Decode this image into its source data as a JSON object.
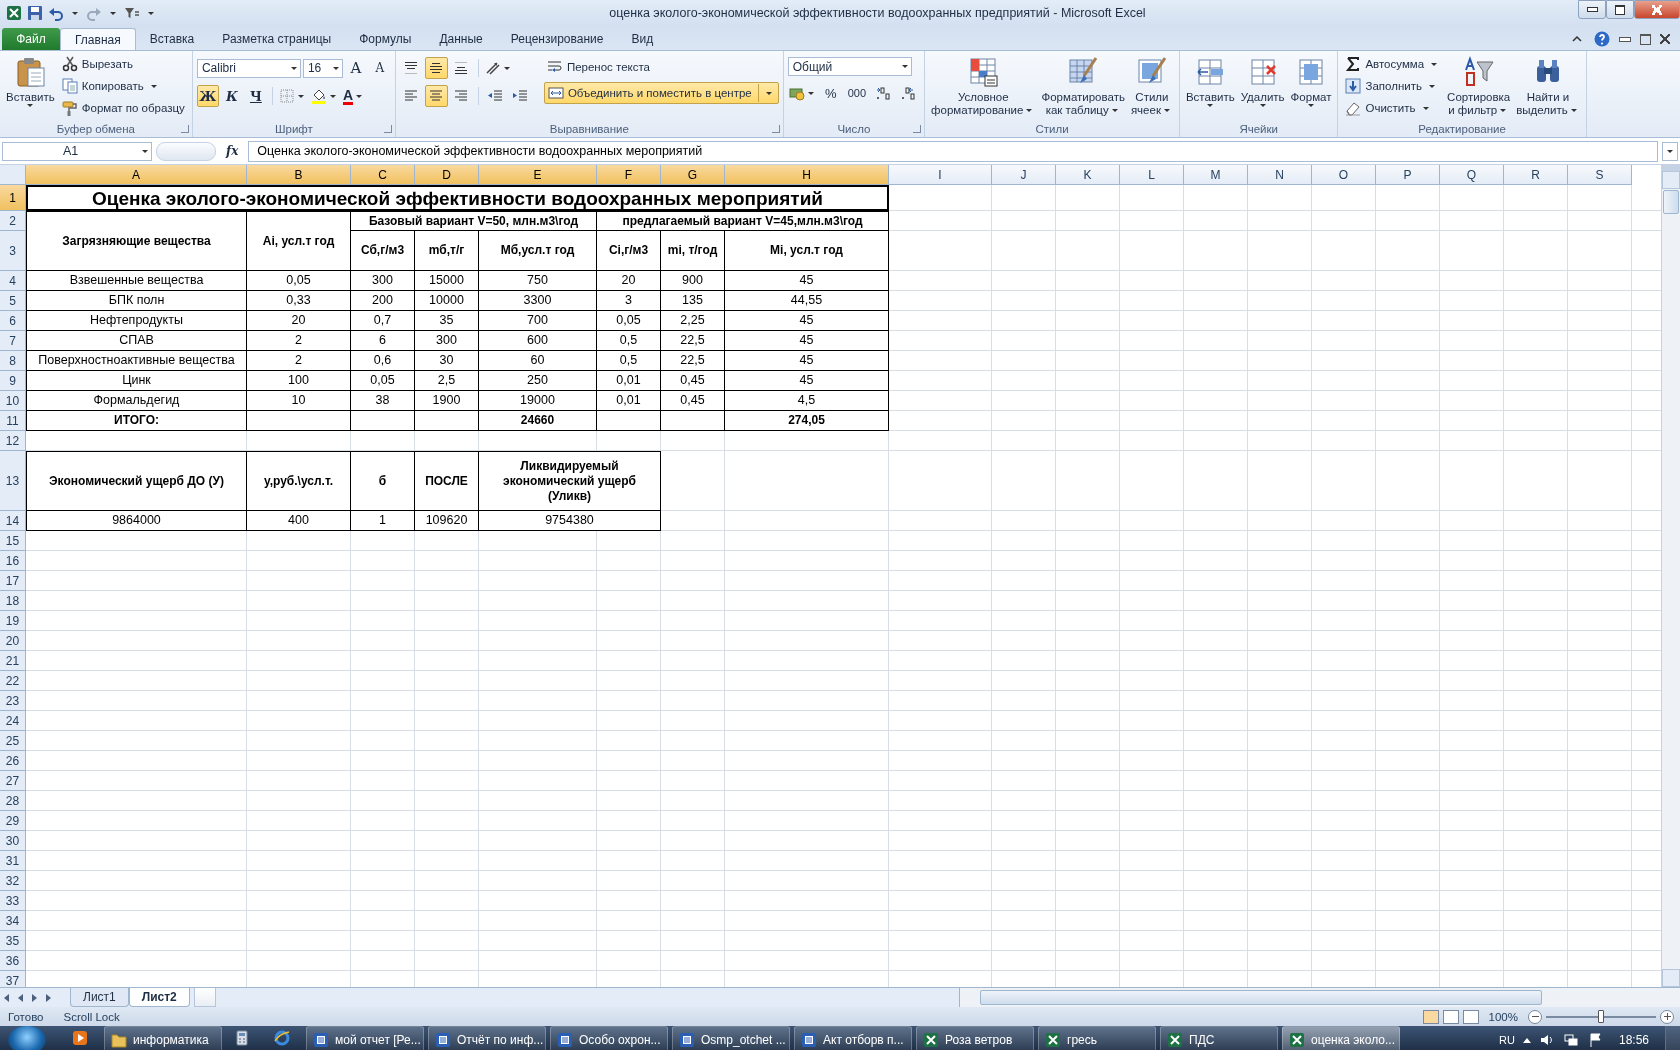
{
  "window": {
    "title": "оценка эколого-экономической эффективности водоохранных предприятий  -  Microsoft Excel"
  },
  "ribbon": {
    "file_tab": "Файл",
    "tabs": [
      {
        "label": "Главная",
        "selected": true
      },
      {
        "label": "Вставка",
        "selected": false
      },
      {
        "label": "Разметка страницы",
        "selected": false
      },
      {
        "label": "Формулы",
        "selected": false
      },
      {
        "label": "Данные",
        "selected": false
      },
      {
        "label": "Рецензирование",
        "selected": false
      },
      {
        "label": "Вид",
        "selected": false
      }
    ],
    "clipboard": {
      "label": "Буфер обмена",
      "paste": "Вставить",
      "cut": "Вырезать",
      "copy": "Копировать",
      "format_painter": "Формат по образцу"
    },
    "font": {
      "label": "Шрифт",
      "name": "Calibri",
      "size": "16",
      "grow": "A",
      "shrink": "A",
      "text_color_label": "A",
      "styles": [
        {
          "text": "Ж",
          "selected": true
        },
        {
          "text": "К",
          "selected": false
        },
        {
          "text": "Ч",
          "selected": false
        }
      ]
    },
    "alignment": {
      "label": "Выравнивание",
      "wrap": "Перенос текста",
      "merge": {
        "text": "Объединить и поместить в центре",
        "selected": true
      },
      "vertical": [
        {
          "selected": false
        },
        {
          "selected": true
        },
        {
          "selected": false
        }
      ],
      "horizontal": [
        {
          "selected": false
        },
        {
          "selected": true
        },
        {
          "selected": false
        }
      ]
    },
    "number": {
      "label": "Число",
      "format": "Общий",
      "percent": "%",
      "thousands": "000"
    },
    "styles": {
      "label": "Стили",
      "buttons": [
        "Условное\nформатирование",
        "Форматировать\nкак таблицу",
        "Стили\nячеек"
      ]
    },
    "cells": {
      "label": "Ячейки",
      "buttons": [
        "Вставить",
        "Удалить",
        "Формат"
      ]
    },
    "editing": {
      "label": "Редактирование",
      "autosum": "Автосумма",
      "fill": "Заполнить",
      "clear": "Очистить",
      "sort": "Сортировка\nи фильтр",
      "find": "Найти и\nвыделить"
    }
  },
  "formula_bar": {
    "name_box": "A1",
    "function_label": "fx",
    "formula": "Оценка эколого-экономической эффективности водоохранных мероприятий"
  },
  "sheet": {
    "columns": [
      {
        "label": "A",
        "selected": true
      },
      {
        "label": "B",
        "selected": true
      },
      {
        "label": "C",
        "selected": true
      },
      {
        "label": "D",
        "selected": true
      },
      {
        "label": "E",
        "selected": true
      },
      {
        "label": "F",
        "selected": true
      },
      {
        "label": "G",
        "selected": true
      },
      {
        "label": "H",
        "selected": true
      },
      {
        "label": "I",
        "selected": false
      },
      {
        "label": "J",
        "selected": false
      },
      {
        "label": "K",
        "selected": false
      },
      {
        "label": "L",
        "selected": false
      },
      {
        "label": "M",
        "selected": false
      },
      {
        "label": "N",
        "selected": false
      },
      {
        "label": "O",
        "selected": false
      },
      {
        "label": "P",
        "selected": false
      },
      {
        "label": "Q",
        "selected": false
      },
      {
        "label": "R",
        "selected": false
      },
      {
        "label": "S",
        "selected": false
      }
    ],
    "rows": [
      {
        "label": "1",
        "selected": true
      },
      {
        "label": "2",
        "selected": false
      },
      {
        "label": "3",
        "selected": false
      },
      {
        "label": "4",
        "selected": false
      },
      {
        "label": "5",
        "selected": false
      },
      {
        "label": "6",
        "selected": false
      },
      {
        "label": "7",
        "selected": false
      },
      {
        "label": "8",
        "selected": false
      },
      {
        "label": "9",
        "selected": false
      },
      {
        "label": "10",
        "selected": false
      },
      {
        "label": "11",
        "selected": false
      },
      {
        "label": "12",
        "selected": false
      },
      {
        "label": "13",
        "selected": false
      },
      {
        "label": "14",
        "selected": false
      },
      {
        "label": "15",
        "selected": false
      },
      {
        "label": "16",
        "selected": false
      },
      {
        "label": "17",
        "selected": false
      },
      {
        "label": "18",
        "selected": false
      },
      {
        "label": "19",
        "selected": false
      },
      {
        "label": "20",
        "selected": false
      },
      {
        "label": "21",
        "selected": false
      },
      {
        "label": "22",
        "selected": false
      },
      {
        "label": "23",
        "selected": false
      },
      {
        "label": "24",
        "selected": false
      },
      {
        "label": "25",
        "selected": false
      },
      {
        "label": "26",
        "selected": false
      },
      {
        "label": "27",
        "selected": false
      },
      {
        "label": "28",
        "selected": false
      },
      {
        "label": "29",
        "selected": false
      },
      {
        "label": "30",
        "selected": false
      },
      {
        "label": "31",
        "selected": false
      },
      {
        "label": "32",
        "selected": false
      },
      {
        "label": "33",
        "selected": false
      },
      {
        "label": "34",
        "selected": false
      },
      {
        "label": "35",
        "selected": false
      },
      {
        "label": "36",
        "selected": false
      },
      {
        "label": "37",
        "selected": false
      }
    ],
    "title": "Оценка эколого-экономической эффективности водоохранных мероприятий",
    "table": {
      "column_groups": [
        "Базовый вариант V=50, млн.м3\\год",
        "предлагаемый вариант V=45,млн.м3\\год"
      ],
      "columns": [
        "Загрязняющие вещества",
        "Ai, усл.т год",
        "Сб,г/м3",
        "mб,т/г",
        "Мб,усл.т год",
        "Ci,г/м3",
        "mi, т/год",
        "Mi, усл.т год"
      ],
      "rows": [
        [
          "Взвешенные вещества",
          "0,05",
          "300",
          "15000",
          "750",
          "20",
          "900",
          "45"
        ],
        [
          "БПК полн",
          "0,33",
          "200",
          "10000",
          "3300",
          "3",
          "135",
          "44,55"
        ],
        [
          "Нефтепродукты",
          "20",
          "0,7",
          "35",
          "700",
          "0,05",
          "2,25",
          "45"
        ],
        [
          "СПАВ",
          "2",
          "6",
          "300",
          "600",
          "0,5",
          "22,5",
          "45"
        ],
        [
          "Поверхностноактивные вещества",
          "2",
          "0,6",
          "30",
          "60",
          "0,5",
          "22,5",
          "45"
        ],
        [
          "Цинк",
          "100",
          "0,05",
          "2,5",
          "250",
          "0,01",
          "0,45",
          "45"
        ],
        [
          "Формальдегид",
          "10",
          "38",
          "1900",
          "19000",
          "0,01",
          "0,45",
          "4,5"
        ]
      ],
      "total": {
        "label": "ИТОГО:",
        "base": "24660",
        "proposed": "274,05"
      }
    },
    "damage_table": {
      "headers": [
        "Экономический ущерб ДО (У)",
        "у,руб.\\усл.т.",
        "б",
        "ПОСЛЕ",
        "Ликвидируемый экономический ущерб (Уликв)"
      ],
      "values": [
        "9864000",
        "400",
        "1",
        "109620",
        "9754380"
      ]
    }
  },
  "sheet_tabs": [
    {
      "label": "Лист1",
      "selected": false
    },
    {
      "label": "Лист2",
      "selected": true
    }
  ],
  "status_bar": {
    "state": "Готово",
    "scroll_lock": "Scroll Lock",
    "zoom": {
      "text": "100%",
      "level": 0.5
    }
  },
  "taskbar": {
    "items": [
      {
        "kind": "folder",
        "label": "информатика",
        "selected": false
      },
      {
        "kind": "word",
        "label": "мой отчет [Ре...",
        "selected": false
      },
      {
        "kind": "word",
        "label": "Отчёт по инф...",
        "selected": false
      },
      {
        "kind": "word",
        "label": "Особо охрон...",
        "selected": false
      },
      {
        "kind": "word",
        "label": "Osmp_otchet ...",
        "selected": false
      },
      {
        "kind": "word",
        "label": "Акт отборв п...",
        "selected": false
      },
      {
        "kind": "excel",
        "label": "Роза ветров",
        "selected": false
      },
      {
        "kind": "excel",
        "label": "гресь",
        "selected": false
      },
      {
        "kind": "excel",
        "label": "ПДС",
        "selected": false
      },
      {
        "kind": "excel",
        "label": "оценка эколо...",
        "selected": true
      }
    ],
    "language": "RU",
    "clock": "18:56"
  }
}
